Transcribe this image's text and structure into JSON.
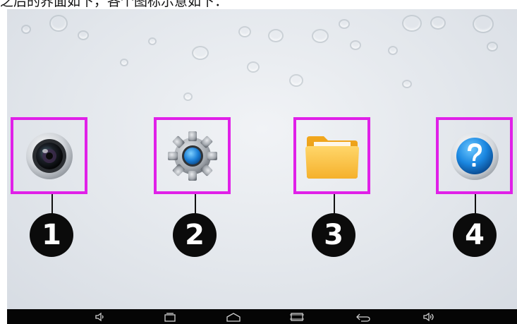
{
  "caption": "之后的界面如下，各个图标示意如下：",
  "colors": {
    "highlight": "#e020e8",
    "badge": "#0b0b0b",
    "navbar": "#050505"
  },
  "apps": [
    {
      "icon": "camera-icon",
      "callout": "1"
    },
    {
      "icon": "settings-gear-icon",
      "callout": "2"
    },
    {
      "icon": "folder-icon",
      "callout": "3"
    },
    {
      "icon": "help-icon",
      "callout": "4"
    }
  ],
  "navbar": {
    "buttons": [
      "volume-down-icon",
      "recent-apps-icon",
      "home-icon",
      "screenshot-icon",
      "back-icon",
      "volume-up-icon"
    ]
  }
}
